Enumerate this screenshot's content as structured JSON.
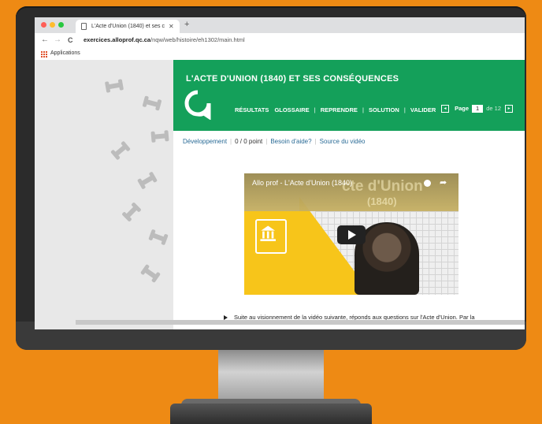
{
  "browser": {
    "tab_title": "L'Acte d'Union (1840) et ses c",
    "tab_close": "✕",
    "new_tab": "+",
    "back": "←",
    "forward": "→",
    "reload": "C",
    "url_host": "exercices.alloprof.qc.ca",
    "url_path": "/nqw/web/histoire/eh1302/main.html",
    "bookmark_apps": "Applications",
    "colors": {
      "close": "#ff5f57",
      "minimize": "#febc2e",
      "maximize": "#28c840"
    }
  },
  "page": {
    "title": "L'ACTE D'UNION (1840) ET SES CONSÉQUENCES",
    "menu": {
      "resultats": "RÉSULTATS",
      "glossaire": "GLOSSAIRE",
      "reprendre": "REPRENDRE",
      "solution": "SOLUTION",
      "valider": "VALIDER",
      "separator": "|"
    },
    "pager": {
      "label": "Page",
      "current": "1",
      "of": "de",
      "total": "12",
      "prev": "◂",
      "next": "▸"
    },
    "info": {
      "developpement": "Développement",
      "score": "0 / 0 point",
      "aide": "Besoin d'aide?",
      "source": "Source du vidéo",
      "sep": "|"
    },
    "video": {
      "title": "Allo prof - L'Acte d'Union (1840)",
      "overlay_big": "cte d'Union",
      "overlay_year": "(1840)",
      "share": "➦"
    },
    "instruction": "Suite au visionnement de la vidéo suivante, réponds aux questions sur l'Acte d'Union. Par la",
    "accent": "#14a05a"
  }
}
